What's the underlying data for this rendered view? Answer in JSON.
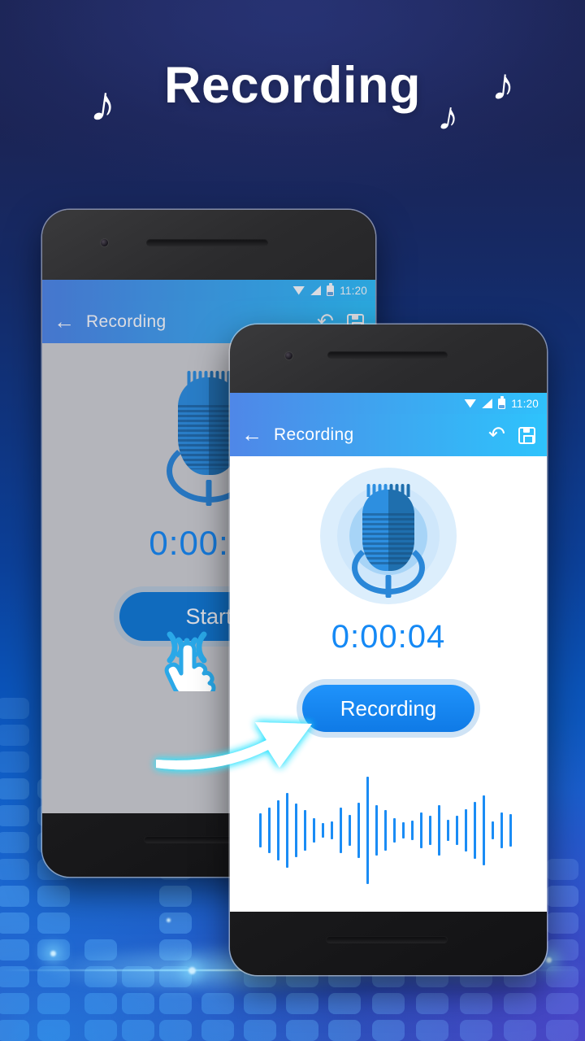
{
  "header": {
    "title": "Recording",
    "notes": [
      "♪",
      "♪",
      "♪"
    ]
  },
  "colors": {
    "accent_blue": "#1589f5",
    "appbar_left": "#4f87e8",
    "appbar_right": "#2ec3fc",
    "bg_top": "#1b2352",
    "bg_bottom": "#3a3fa8",
    "mic_light": "#2d8fe0",
    "mic_dark": "#1f6fae",
    "halo": "#a7d4f7",
    "button_ring": "#cfe3f5"
  },
  "front_phone": {
    "statusbar": {
      "wifi_icon": "wifi-icon",
      "signal_icon": "signal-icon",
      "battery_icon": "battery-icon",
      "clock": "11:20"
    },
    "appbar": {
      "back_icon": "←",
      "title": "Recording",
      "undo_icon": "↶",
      "save_icon": "save-icon"
    },
    "mic_icon": "microphone-icon",
    "timer": "0:00:04",
    "record_button_label": "Recording",
    "waveform": {
      "bar_color": "#1a8cf5",
      "heights": [
        42,
        56,
        74,
        92,
        66,
        50,
        30,
        18,
        22,
        56,
        38,
        68,
        132,
        62,
        50,
        30,
        20,
        24,
        44,
        36,
        62,
        26,
        36,
        52,
        70,
        86,
        22,
        44,
        40
      ]
    }
  },
  "back_phone": {
    "statusbar": {
      "wifi_icon": "wifi-icon",
      "signal_icon": "signal-icon",
      "battery_icon": "battery-icon",
      "clock": "11:20"
    },
    "appbar": {
      "back_icon": "←",
      "title": "Recording",
      "undo_icon": "↶",
      "save_icon": "save-icon"
    },
    "mic_icon": "microphone-icon",
    "timer": "0:00:00",
    "record_button_label": "Start",
    "tap_icon": "tap-hand-icon"
  },
  "annotations": {
    "arrow_icon": "curved-arrow-icon"
  }
}
